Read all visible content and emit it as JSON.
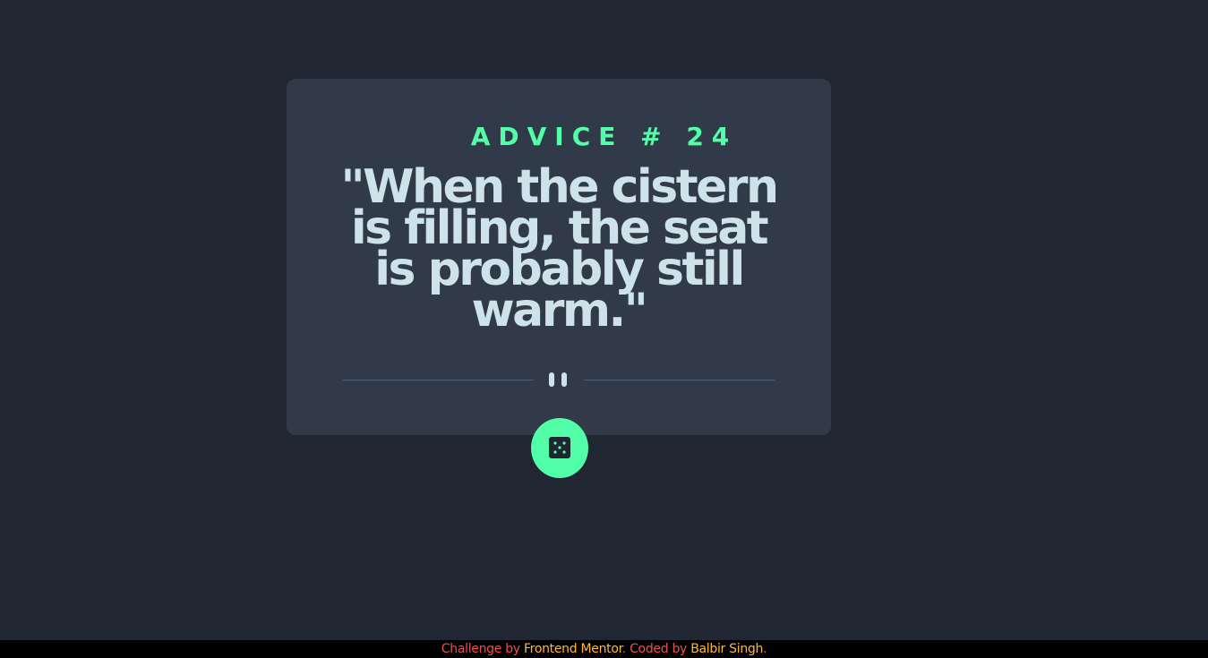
{
  "advice": {
    "heading": "ADVICE # 24",
    "quote": "\"When the cistern is filling, the seat is probably still warm.\""
  },
  "actions": {
    "dice_icon": "dice-icon",
    "divider_icon": "pause-icon"
  },
  "footer": {
    "challenge_by": "Challenge by ",
    "frontend_mentor": "Frontend Mentor",
    "coded_by": ". Coded by ",
    "author": "Balbir Singh",
    "end": "."
  },
  "colors": {
    "background": "#202632",
    "card": "#313a49",
    "accent": "#52ffa8",
    "quote_text": "#cee3e9",
    "divider": "#4f5d74",
    "footer_muted": "#ee4f4f",
    "footer_link": "#ffb836"
  }
}
